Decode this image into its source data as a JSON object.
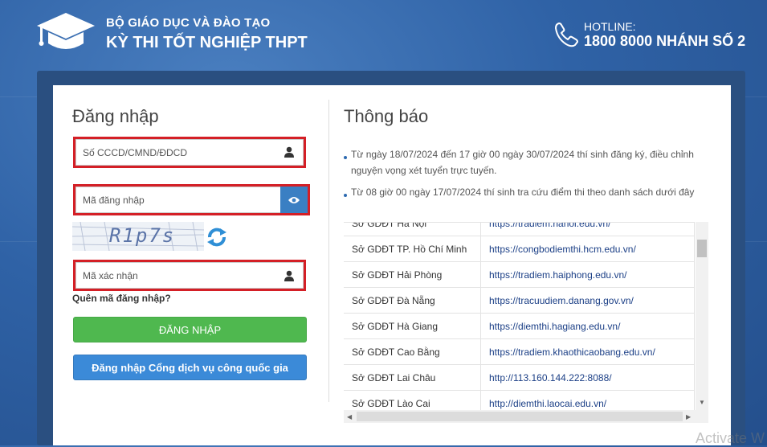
{
  "header": {
    "org": "BỘ GIÁO DỤC VÀ ĐÀO TẠO",
    "exam": "KỲ THI TỐT NGHIỆP THPT",
    "hotline_label": "HOTLINE:",
    "hotline_number": "1800 8000 NHÁNH SỐ 2"
  },
  "login": {
    "title": "Đăng nhập",
    "id_placeholder": "Số CCCD/CMND/ĐDCD",
    "code_placeholder": "Mã đăng nhập",
    "captcha_text": "R1p7s",
    "verify_placeholder": "Mã xác nhận",
    "forgot": "Quên mã đăng nhập?",
    "login_button": "ĐĂNG NHẬP",
    "gov_button": "Đăng nhập Cổng dịch vụ công quốc gia"
  },
  "notice": {
    "title": "Thông báo",
    "line1a": "Từ ngày 18/07/2024 đến 17 giờ 00 ngày 30/07/2024 thí sinh đăng ký, điều chỉnh",
    "line1b": "nguyện vọng xét tuyển trực tuyến.",
    "line2": "Từ 08 giờ 00 ngày 17/07/2024 thí sinh tra cứu điểm thi theo danh sách dưới đây",
    "rows": [
      {
        "so": "Sở GDĐT Hà Nội",
        "url": "https://tradiem.hanoi.edu.vn/"
      },
      {
        "so": "Sở GDĐT TP. Hồ Chí Minh",
        "url": "https://congbodiemthi.hcm.edu.vn/"
      },
      {
        "so": "Sở GDĐT Hải Phòng",
        "url": "https://tradiem.haiphong.edu.vn/"
      },
      {
        "so": "Sở GDĐT Đà Nẵng",
        "url": "https://tracuudiem.danang.gov.vn/"
      },
      {
        "so": "Sở GDĐT Hà Giang",
        "url": "https://diemthi.hagiang.edu.vn/"
      },
      {
        "so": "Sở GDĐT Cao Bằng",
        "url": "https://tradiem.khaothicaobang.edu.vn/"
      },
      {
        "so": "Sở GDĐT Lai Châu",
        "url": "http://113.160.144.222:8088/"
      },
      {
        "so": "Sở GDĐT Lào Cai",
        "url": "http://diemthi.laocai.edu.vn/"
      }
    ]
  },
  "watermark": "Activate W",
  "colors": {
    "highlight": "#d41f26",
    "login_button": "#4fb84f",
    "gov_button": "#3b8ad8",
    "link": "#1b3f86"
  }
}
